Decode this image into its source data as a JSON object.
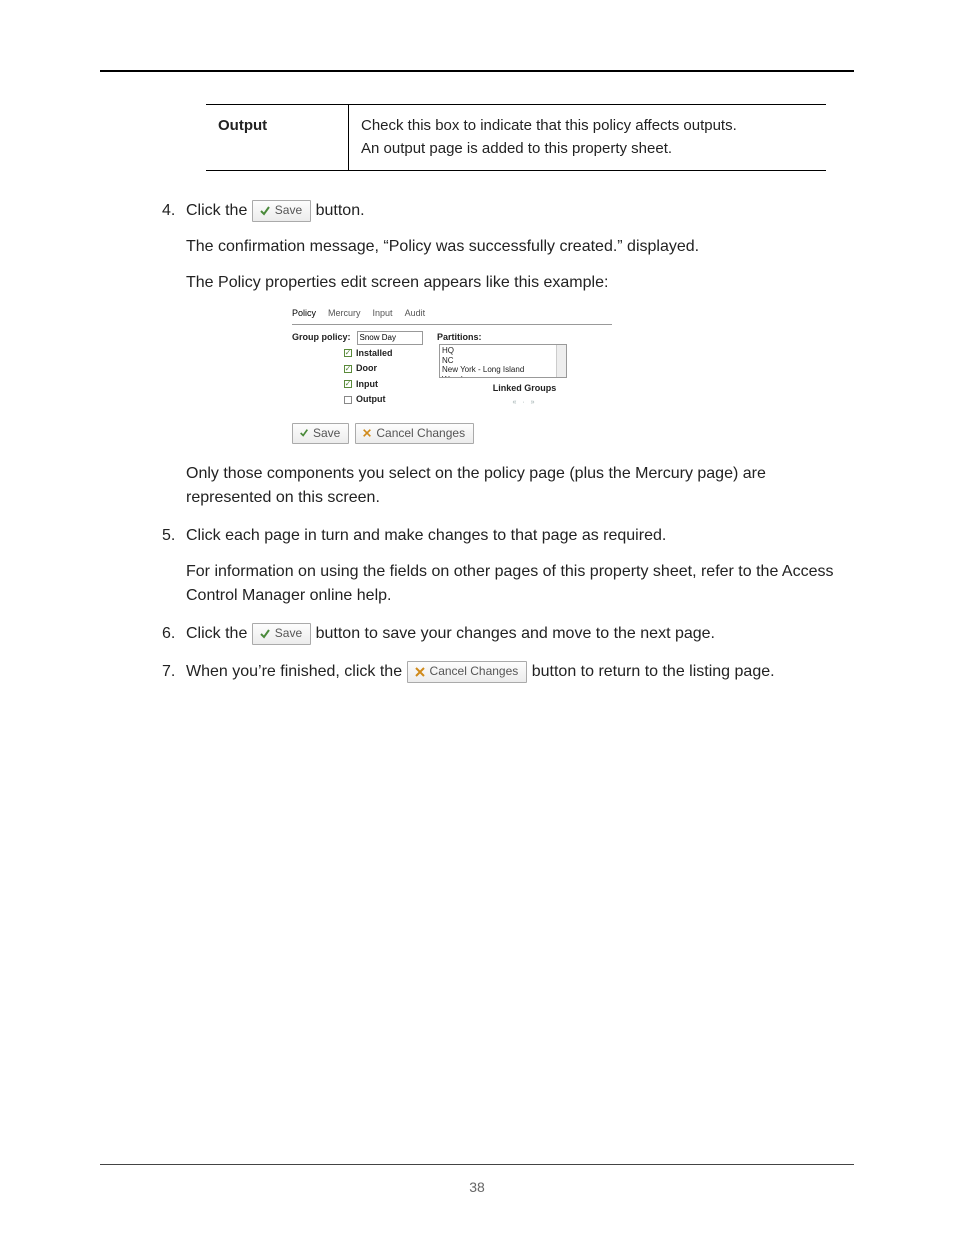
{
  "page_number": "38",
  "def_table": {
    "label": "Output",
    "desc_line1": "Check this box to indicate that this policy affects outputs.",
    "desc_line2": "An output page is added to this property sheet."
  },
  "buttons": {
    "save": "Save",
    "cancel": "Cancel Changes"
  },
  "steps": {
    "s4": {
      "num": "4.",
      "prefix": "Click the ",
      "suffix": " button.",
      "p2": "The confirmation message, “Policy was successfully created.” displayed.",
      "p3": "The Policy properties edit screen appears like this example:",
      "p4": "Only those components you select on the policy page (plus the Mercury page) are represented on this screen."
    },
    "s5": {
      "num": "5.",
      "p1": "Click each page in turn and make changes to that page as required.",
      "p2": "For information on using the fields on other pages of this property sheet, refer to the Access Control Manager online help."
    },
    "s6": {
      "num": "6.",
      "prefix": "Click the ",
      "suffix": " button to save your changes and move to the next page."
    },
    "s7": {
      "num": "7.",
      "prefix": "When you’re finished, click the ",
      "suffix": " button to return to the listing page."
    }
  },
  "mock": {
    "tabs": [
      "Policy",
      "Mercury",
      "Input",
      "Audit"
    ],
    "group_policy_label": "Group policy:",
    "group_policy_value": "Snow Day",
    "checkboxes": [
      {
        "label": "Installed",
        "checked": true
      },
      {
        "label": "Door",
        "checked": true
      },
      {
        "label": "Input",
        "checked": true
      },
      {
        "label": "Output",
        "checked": false
      }
    ],
    "partitions_label": "Partitions:",
    "partitions": [
      "HQ",
      "NC",
      "New York - Long Island Warehouse"
    ],
    "linked_label": "Linked Groups",
    "pager": "« · »"
  }
}
